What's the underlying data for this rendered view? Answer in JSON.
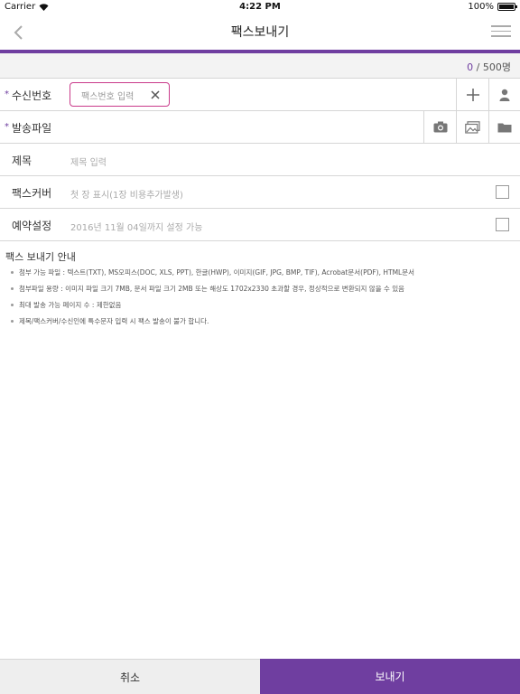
{
  "status_bar": {
    "carrier": "Carrier",
    "time": "4:22 PM",
    "battery": "100%"
  },
  "nav": {
    "title": "팩스보내기"
  },
  "counter": {
    "current": "0",
    "max": "/ 500명"
  },
  "form": {
    "recipient": {
      "label": "수신번호",
      "placeholder": "팩스번호 입력"
    },
    "attachment": {
      "label": "발송파일"
    },
    "subject": {
      "label": "제목",
      "placeholder": "제목 입력"
    },
    "cover": {
      "label": "팩스커버",
      "placeholder": "첫 장 표시(1장 비용추가발생)"
    },
    "reservation": {
      "label": "예약설정",
      "placeholder": "2016년 11월 04일까지 설정 가능"
    }
  },
  "guide": {
    "title": "팩스 보내기 안내",
    "items": [
      "첨부 가능 파일 : 텍스트(TXT), MS오피스(DOC, XLS, PPT), 한글(HWP), 이미지(GIF, JPG, BMP, TIF), Acrobat문서(PDF), HTML문서",
      "첨부파일 용량 : 이미지 파일 크기 7MB, 문서 파일 크기 2MB 또는 해상도 1702x2330 초과할 경우, 정상적으로 변환되지 않을 수 있음",
      "최대 발송 가능 페이지 수 : 제한없음",
      "제목/팩스커버/수신인에 특수문자 입력 시 팩스 발송이 불가 합니다."
    ]
  },
  "buttons": {
    "cancel": "취소",
    "send": "보내기"
  },
  "colors": {
    "accent": "#6f3ea0",
    "input_border": "#c93a8a"
  }
}
